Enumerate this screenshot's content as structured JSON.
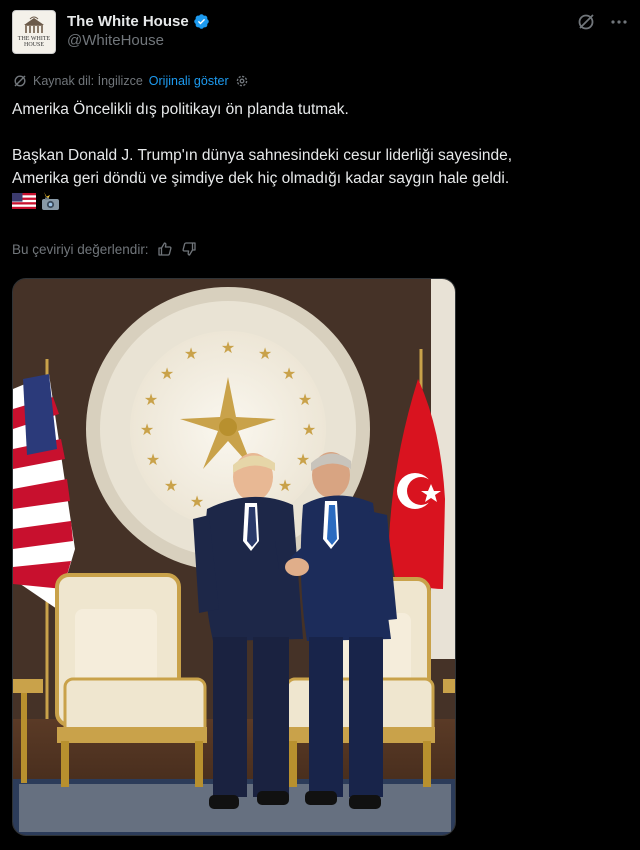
{
  "account": {
    "display_name": "The White House",
    "handle": "@WhiteHouse",
    "avatar_text": "THE WHITE HOUSE"
  },
  "translation": {
    "source_label": "Kaynak dil: İngilizce",
    "show_original": "Orijinali göster"
  },
  "tweet": {
    "line1": "Amerika Öncelikli dış politikayı ön planda tutmak.",
    "line2": "Başkan Donald J. Trump'ın dünya sahnesindeki cesur liderliği sayesinde,",
    "line3": "Amerika geri döndü ve şimdiye dek hiç olmadığı kadar saygın hale geldi.",
    "emojis": [
      "us-flag-emoji",
      "camera-flash-emoji"
    ]
  },
  "rating": {
    "label": "Bu çeviriyi değerlendir:"
  },
  "colors": {
    "background": "#000000",
    "text": "#e7e9ea",
    "secondary": "#71767b",
    "link": "#1d9bf0",
    "verified": "#1d9bf0"
  },
  "icons": [
    "grok-icon",
    "more-icon",
    "translate-icon",
    "settings-icon",
    "thumbs-up-icon",
    "thumbs-down-icon",
    "verified-badge-icon"
  ]
}
